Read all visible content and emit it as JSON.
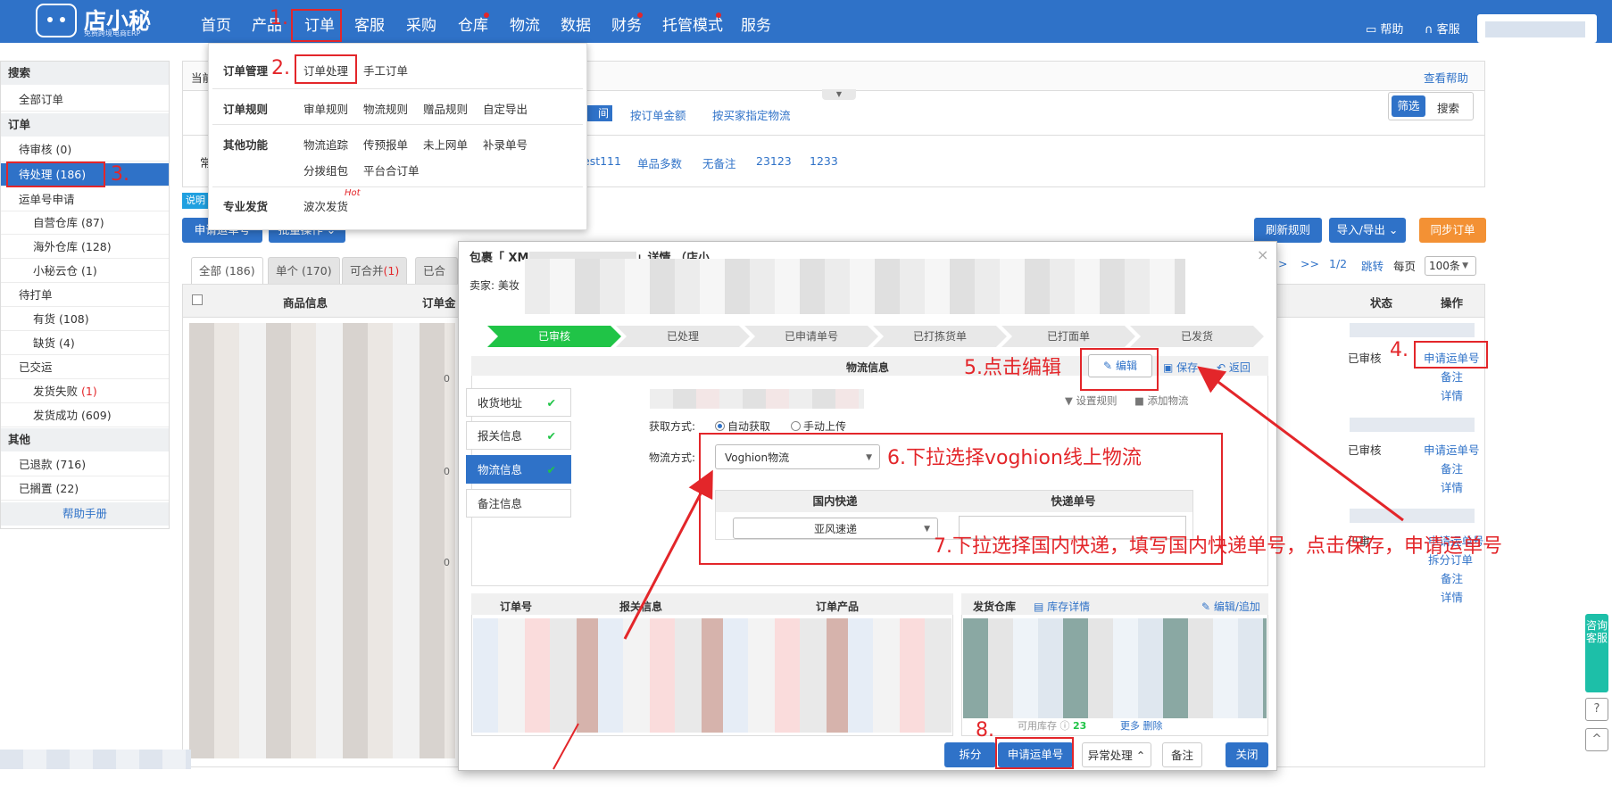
{
  "app": {
    "logo_text": "店小秘",
    "logo_sub": "免费跨境电商ERP"
  },
  "nav": [
    "首页",
    "产品",
    "订单",
    "客服",
    "采购",
    "仓库",
    "物流",
    "数据",
    "财务",
    "托管模式",
    "服务"
  ],
  "topright": {
    "help": "帮助",
    "service": "客服"
  },
  "sidebar": {
    "search": "搜索",
    "all": "全部订单",
    "order": "订单",
    "pending_review": "待审核",
    "pending_review_count": "(0)",
    "pending_process": "待处理",
    "pending_process_count": "(186)",
    "waybill_apply": "运单号申请",
    "self_wh": "自营仓库",
    "self_wh_count": "(87)",
    "overseas_wh": "海外仓库",
    "overseas_wh_count": "(128)",
    "cloud_wh": "小秘云仓",
    "cloud_wh_count": "(1)",
    "to_print": "待打单",
    "in_stock": "有货",
    "in_stock_count": "(108)",
    "out_stock": "缺货",
    "out_stock_count": "(4)",
    "shipped": "已交运",
    "ship_fail": "发货失败",
    "ship_fail_count": "(1)",
    "ship_ok": "发货成功",
    "ship_ok_count": "(609)",
    "other": "其他",
    "refunded": "已退款",
    "refunded_count": "(716)",
    "shelved": "已搁置",
    "shelved_count": "(22)",
    "manual": "帮助手册"
  },
  "dropdown": {
    "order_mgmt": "订单管理",
    "order_process": "订单处理",
    "manual_order": "手工订单",
    "order_rules": "订单规则",
    "review_rules": "审单规则",
    "logistics_rules": "物流规则",
    "gift_rules": "赠品规则",
    "custom_export": "自定导出",
    "other_func": "其他功能",
    "tracking": "物流追踪",
    "prereport": "传预报单",
    "not_online": "未上网单",
    "supplement": "补录单号",
    "split_pack": "分拨组包",
    "platform_merge": "平台合订单",
    "pro_ship": "专业发货",
    "wave_ship": "波次发货",
    "hot": "Hot"
  },
  "page": {
    "current_prefix": "当前",
    "help_center": "查看帮助",
    "filter_items": [
      "按订单金额",
      "按买家指定物流"
    ],
    "filter_partial": "间",
    "filter_btn": "筛选",
    "search_btn": "搜索",
    "common_prefix": "常",
    "tag_partial": "est111",
    "tags": [
      "单品多数",
      "无备注",
      "23123",
      "1233"
    ],
    "explain": "说明",
    "apply_waybill": "申请运单号",
    "batch_ops": "批量操作",
    "refresh_rules": "刷新规则",
    "import_export": "导入/导出",
    "sync_orders": "同步订单",
    "tabs": [
      "全部 (186)",
      "单个 (170)",
      "可合并",
      "已合并"
    ],
    "mergeable_count": "(1)",
    "pager": {
      "gt": ">",
      "gtgt": ">>",
      "page": "1/2",
      "jump": "跳转",
      "per_page": "每页",
      "size": "100条"
    },
    "col_check": "",
    "col_product": "商品信息",
    "col_amount": "订单金",
    "col_status": "状态",
    "col_ops": "操作",
    "amount_tail": "0",
    "rows": [
      {
        "status": "已审核",
        "ops": [
          "申请运单号",
          "备注",
          "详情"
        ]
      },
      {
        "status": "已审核",
        "ops": [
          "申请运单号",
          "备注",
          "详情"
        ]
      },
      {
        "status": "已审",
        "ops": [
          "申请运单号",
          "拆分订单",
          "备注",
          "详情"
        ]
      }
    ]
  },
  "modal": {
    "title_prefix": "包裹「 XM",
    "title_mid": "」详情",
    "title_tail": "（店小",
    "seller": "卖家: 美妆",
    "close": "×",
    "steps": [
      "已审核",
      "已处理",
      "已申请单号",
      "已打拣货单",
      "已打面单",
      "已发货"
    ],
    "section": "物流信息",
    "edit": "编辑",
    "save": "保存",
    "back": "返回",
    "left_tabs": [
      "收货地址",
      "报关信息",
      "物流信息",
      "备注信息"
    ],
    "set_rules": "设置规则",
    "add_logistics": "添加物流",
    "fetch_mode_label": "获取方式:",
    "auto": "自动获取",
    "manual": "手动上传",
    "logistics_label": "物流方式:",
    "logistics_value": "Voghion物流",
    "domestic_header": "国内快递",
    "tracking_header": "快递单号",
    "domestic_value": "亚风速递",
    "order_no": "订单号",
    "customs": "报关信息",
    "order_product": "订单产品",
    "warehouse": "发货仓库",
    "stock_detail": "库存详情",
    "edit_add": "编辑/追加",
    "footer": {
      "split": "拆分",
      "apply": "申请运单号",
      "exception": "异常处理",
      "note": "备注",
      "close": "关闭"
    },
    "stock_label": "可用库存",
    "stock_count": "23",
    "more": "更多",
    "delete": "删除"
  },
  "annotations": {
    "a1": "1.",
    "a2": "2.",
    "a3": "3.",
    "a4": "4.",
    "a5": "5.点击编辑",
    "a6": "6.下拉选择voghion线上物流",
    "a7": "7.下拉选择国内快递，填写国内快递单号，点击保存，申请运单号",
    "a8": "8."
  },
  "float": {
    "consult": "咨询客服",
    "question": "?",
    "top": "^"
  },
  "colors": {
    "brand_blue": "#2f72c8",
    "orange": "#f39134",
    "green": "#20c447",
    "annotation_red": "#e3262a"
  }
}
